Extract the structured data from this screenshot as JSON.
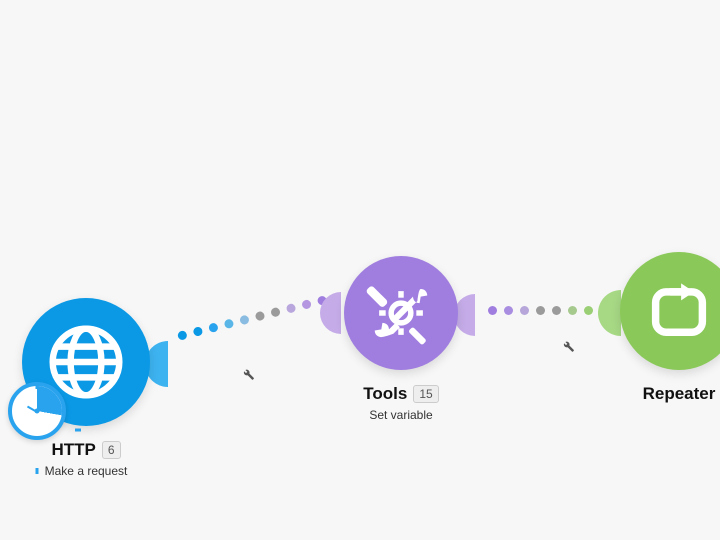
{
  "colors": {
    "http": "#0b99e6",
    "http_light": "#3db3f0",
    "tools": "#a07ee0",
    "tools_light": "#c5ace8",
    "repeater": "#8ac959",
    "repeater_light": "#a7d985",
    "gray_dot": "#9b9b9b"
  },
  "nodes": {
    "http": {
      "title": "HTTP",
      "badge": "6",
      "subtitle": "Make a request"
    },
    "tools": {
      "title": "Tools",
      "badge": "15",
      "subtitle": "Set variable"
    },
    "repeater": {
      "title": "Repeater"
    }
  }
}
